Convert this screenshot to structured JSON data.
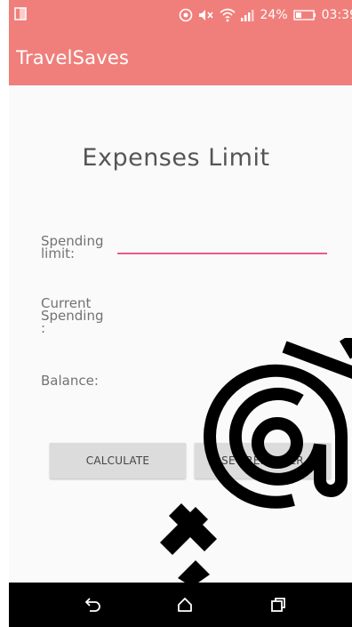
{
  "status_bar": {
    "battery_percent": "24%",
    "time": "03:39"
  },
  "app_bar": {
    "title": "TravelSaves"
  },
  "screen": {
    "title": "Expenses Limit",
    "spending_limit_label": "Spending\nlimit:",
    "spending_limit_value": "",
    "current_spending_label": "Current\nSpending\n:",
    "balance_label": "Balance:",
    "calculate_label": "CALCULATE",
    "set_reminder_label": "SET REMINDER"
  },
  "colors": {
    "app_bar": "#f07f7b",
    "input_underline": "#e85b8a",
    "button_bg": "#dcdcdc",
    "nav_bar": "#000000"
  },
  "icons": {
    "status_left": "screen-rotation-icon",
    "status_right": [
      "eye-icon",
      "mute-icon",
      "wifi-icon",
      "signal-icon",
      "battery-icon"
    ],
    "nav": [
      "back-icon",
      "home-icon",
      "recent-apps-icon"
    ]
  }
}
